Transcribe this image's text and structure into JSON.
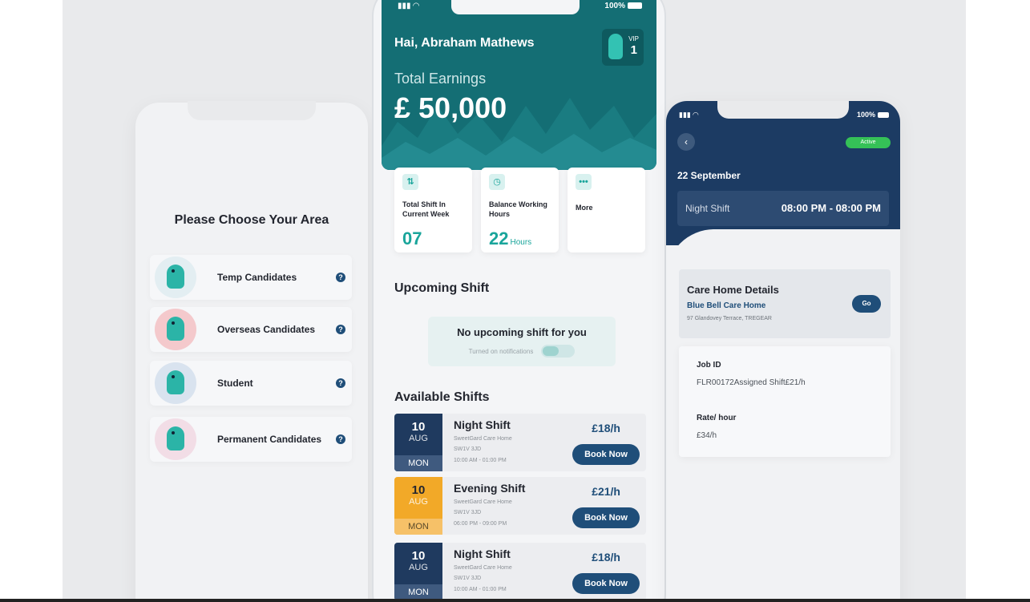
{
  "left_phone": {
    "title": "Please Choose Your Area",
    "items": [
      {
        "label": "Temp Candidates",
        "info": "?"
      },
      {
        "label": "Overseas Candidates",
        "info": "?"
      },
      {
        "label": "Student",
        "info": "?"
      },
      {
        "label": "Permanent Candidates",
        "info": "?"
      }
    ]
  },
  "center_phone": {
    "status_battery": "100%",
    "greeting": "Hai, Abraham Mathews",
    "vip": {
      "label": "VIP",
      "level": "1"
    },
    "earnings": {
      "label": "Total Earnings",
      "value": "£ 50,000"
    },
    "stats": [
      {
        "label": "Total Shift In Current Week",
        "value": "07",
        "unit": ""
      },
      {
        "label": "Balance Working Hours",
        "value": "22",
        "unit": "Hours"
      },
      {
        "label": "More",
        "value": "",
        "unit": ""
      }
    ],
    "upcoming": {
      "title": "Upcoming Shift",
      "empty_title": "No upcoming shift for you",
      "notifications_label": "Turned on notifications"
    },
    "available": {
      "title": "Available Shifts",
      "shifts": [
        {
          "day": "10",
          "month": "AUG",
          "weekday": "MON",
          "title": "Night Shift",
          "home": "SweetGard Care Home",
          "postcode": "SW1V 3JD",
          "time": "10:00 AM - 01:00 PM",
          "rate": "£18/h",
          "button": "Book Now",
          "color": "#1f3a5f",
          "dow_color": "#3f5a7f"
        },
        {
          "day": "10",
          "month": "AUG",
          "weekday": "MON",
          "title": "Evening Shift",
          "home": "SweetGard Care Home",
          "postcode": "SW1V 3JD",
          "time": "06:00 PM - 09:00 PM",
          "rate": "£21/h",
          "button": "Book Now",
          "color": "#f2a928",
          "dow_color": "#f6c168"
        },
        {
          "day": "10",
          "month": "AUG",
          "weekday": "MON",
          "title": "Night Shift",
          "home": "SweetGard Care Home",
          "postcode": "SW1V 3JD",
          "time": "10:00 AM - 01:00 PM",
          "rate": "£18/h",
          "button": "Book Now",
          "color": "#1f3a5f",
          "dow_color": "#3f5a7f"
        }
      ]
    }
  },
  "right_phone": {
    "status_battery": "100%",
    "active_label": "Active",
    "date": "22 September",
    "shift_name": "Night Shift",
    "shift_time": "08:00 PM - 08:00 PM",
    "care_home": {
      "title": "Care Home Details",
      "name": "Blue Bell Care Home",
      "address": "97 Glandovey Terrace, TREGEAR",
      "go_label": "Go"
    },
    "job": {
      "id_label": "Job ID",
      "id_value": "FLR00172Assigned Shift£21/h",
      "rate_label": "Rate/ hour",
      "rate_value": "£34/h"
    }
  }
}
